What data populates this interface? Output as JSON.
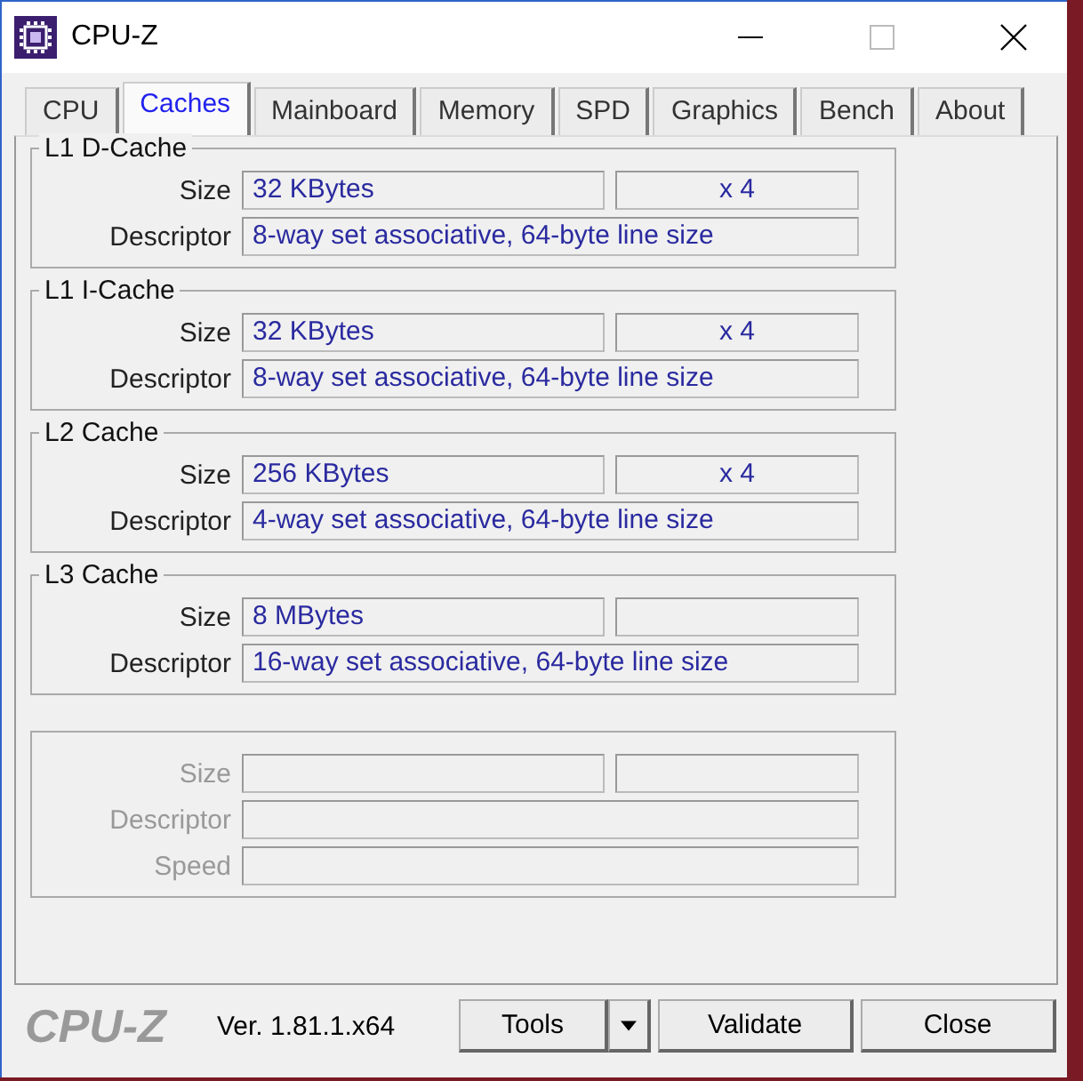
{
  "window": {
    "title": "CPU-Z"
  },
  "tabs": [
    {
      "label": "CPU",
      "selected": false
    },
    {
      "label": "Caches",
      "selected": true
    },
    {
      "label": "Mainboard",
      "selected": false
    },
    {
      "label": "Memory",
      "selected": false
    },
    {
      "label": "SPD",
      "selected": false
    },
    {
      "label": "Graphics",
      "selected": false
    },
    {
      "label": "Bench",
      "selected": false
    },
    {
      "label": "About",
      "selected": false
    }
  ],
  "groups": [
    {
      "title": "L1 D-Cache",
      "disabled": false,
      "rows": [
        {
          "kind": "pair",
          "label": "Size",
          "value": "32 KBytes",
          "extra": "x 4"
        },
        {
          "kind": "wide",
          "label": "Descriptor",
          "value": "8-way set associative, 64-byte line size"
        }
      ]
    },
    {
      "title": "L1 I-Cache",
      "disabled": false,
      "rows": [
        {
          "kind": "pair",
          "label": "Size",
          "value": "32 KBytes",
          "extra": "x 4"
        },
        {
          "kind": "wide",
          "label": "Descriptor",
          "value": "8-way set associative, 64-byte line size"
        }
      ]
    },
    {
      "title": "L2 Cache",
      "disabled": false,
      "rows": [
        {
          "kind": "pair",
          "label": "Size",
          "value": "256 KBytes",
          "extra": "x 4"
        },
        {
          "kind": "wide",
          "label": "Descriptor",
          "value": "4-way set associative, 64-byte line size"
        }
      ]
    },
    {
      "title": "L3 Cache",
      "disabled": false,
      "rows": [
        {
          "kind": "pair",
          "label": "Size",
          "value": "8 MBytes"
        },
        {
          "kind": "wide",
          "label": "Descriptor",
          "value": "16-way set associative, 64-byte line size"
        }
      ]
    },
    {
      "disabled": true,
      "rows": [
        {
          "kind": "pair",
          "label": "Size"
        },
        {
          "kind": "wide",
          "label": "Descriptor"
        },
        {
          "kind": "wide",
          "label": "Speed"
        }
      ]
    }
  ],
  "footer": {
    "logo": "CPU-Z",
    "version": "Ver. 1.81.1.x64",
    "buttons": [
      {
        "label": "Tools",
        "kind": "dropdown"
      },
      {
        "label": "Validate",
        "kind": "plain"
      },
      {
        "label": "Close",
        "kind": "plain"
      }
    ]
  }
}
